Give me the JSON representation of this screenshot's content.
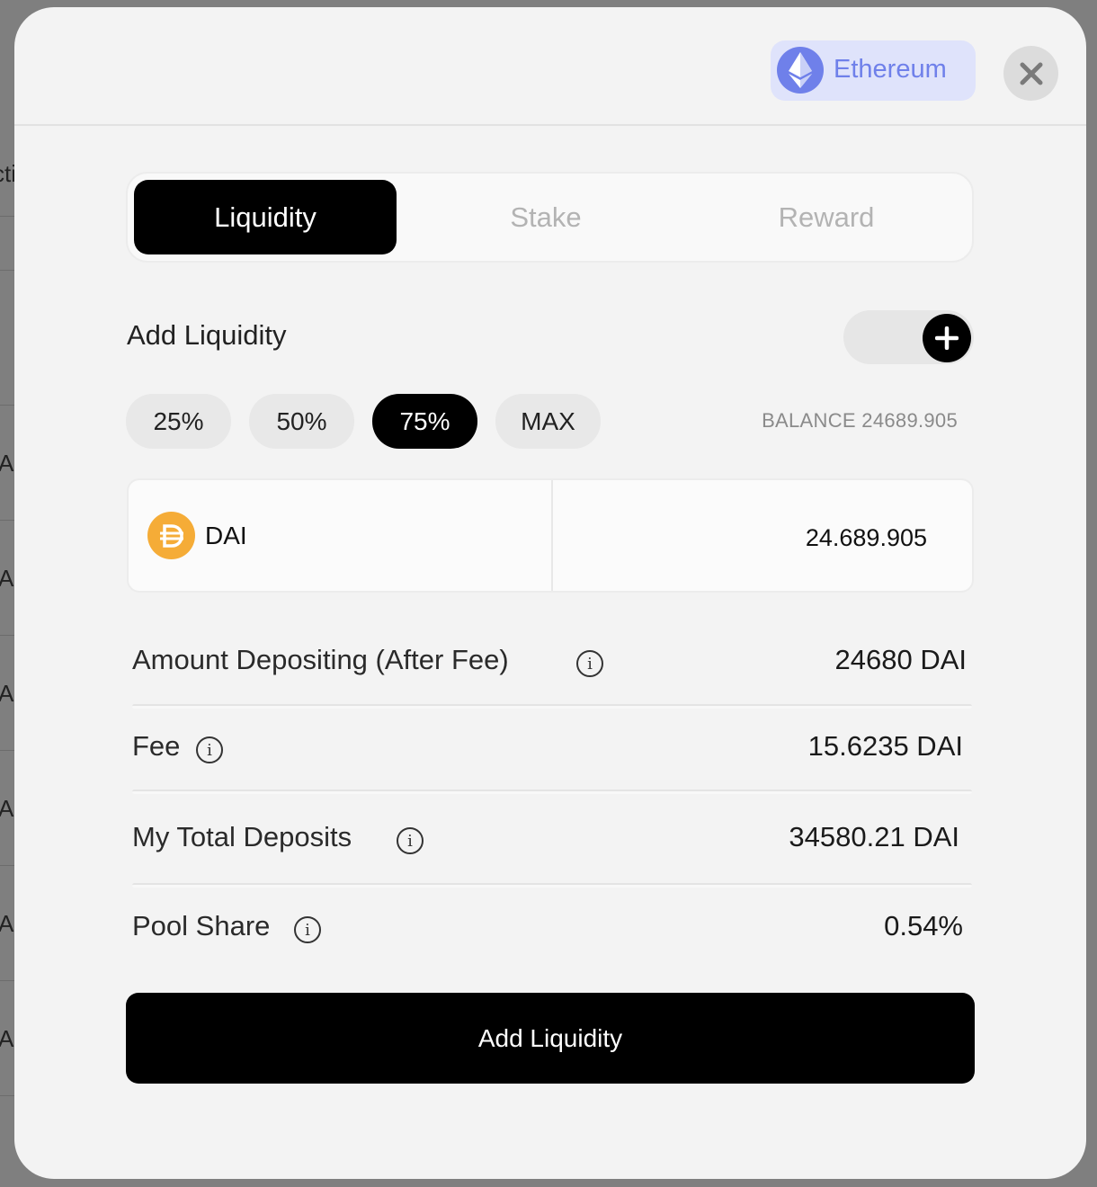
{
  "background": {
    "glyphs": [
      "cti",
      "A",
      "A",
      "A",
      "A",
      "A",
      "A"
    ]
  },
  "header": {
    "network": {
      "label": "Ethereum",
      "icon": "ethereum-icon",
      "color": "#6f80ea"
    },
    "close_icon": "close-icon"
  },
  "tabs": [
    {
      "label": "Liquidity",
      "active": true
    },
    {
      "label": "Stake",
      "active": false
    },
    {
      "label": "Reward",
      "active": false
    }
  ],
  "section": {
    "title": "Add Liquidity",
    "toggle_icon": "plus-icon"
  },
  "percent_buttons": [
    {
      "label": "25%",
      "active": false
    },
    {
      "label": "50%",
      "active": false
    },
    {
      "label": "75%",
      "active": true
    },
    {
      "label": "MAX",
      "active": false
    }
  ],
  "balance": "BALANCE 24689.905",
  "token": {
    "symbol": "DAI",
    "icon": "dai-icon",
    "color": "#f5ac37",
    "amount": "24.689.905"
  },
  "details": [
    {
      "label": "Amount Depositing (After Fee)",
      "value": "24680 DAI"
    },
    {
      "label": "Fee",
      "value": "15.6235 DAI"
    },
    {
      "label": "My Total Deposits",
      "value": "34580.21 DAI"
    },
    {
      "label": "Pool Share",
      "value": "0.54%"
    }
  ],
  "info_glyph": "i",
  "submit_label": "Add Liquidity"
}
